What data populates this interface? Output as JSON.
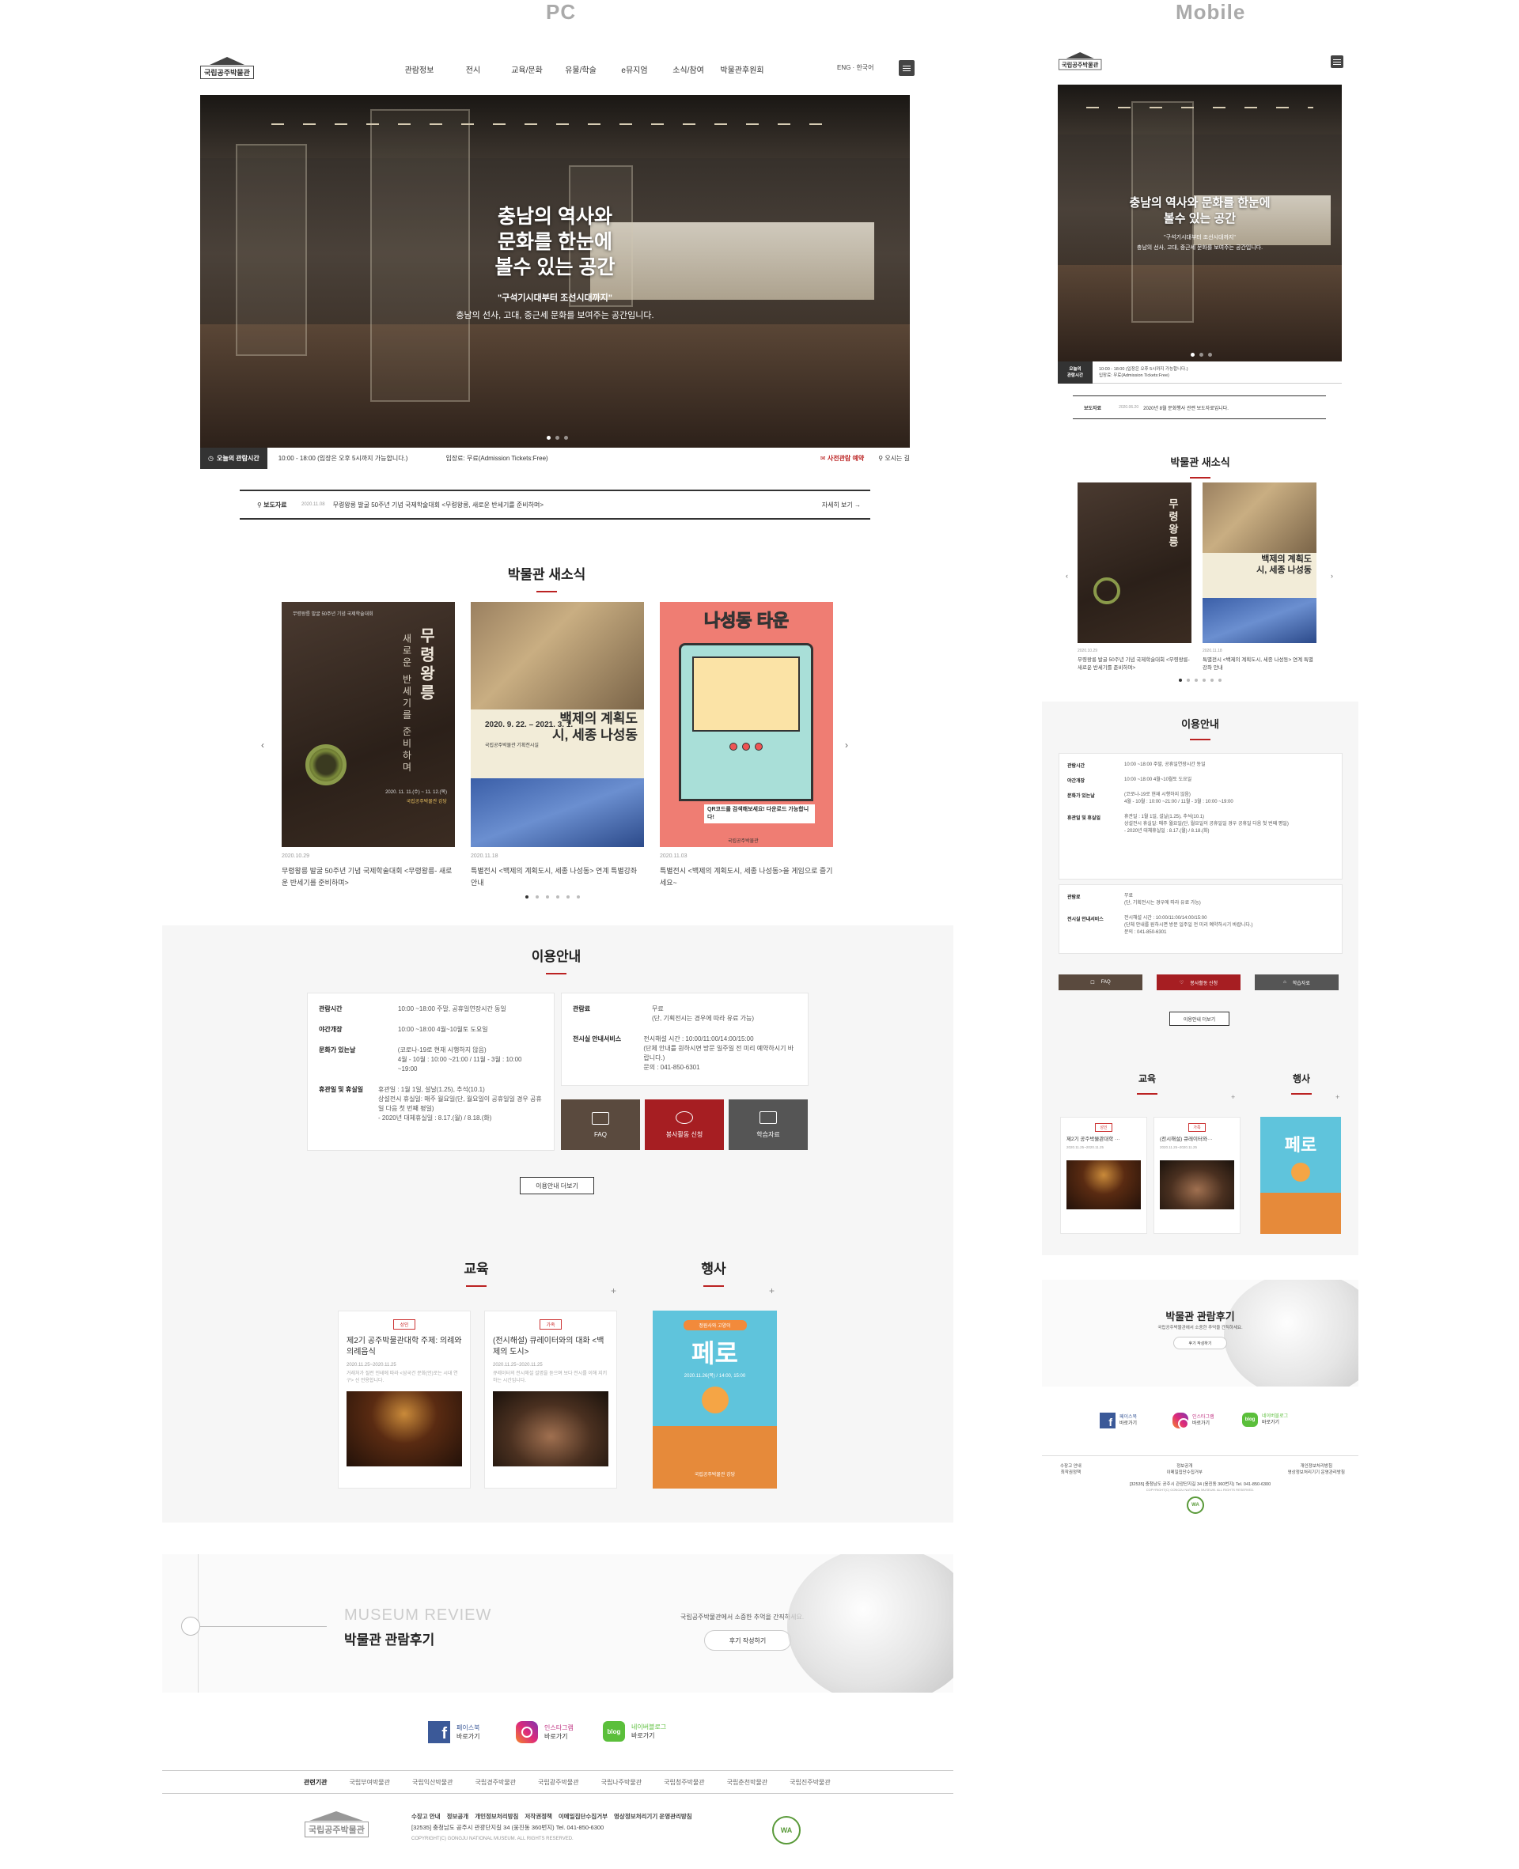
{
  "columns": {
    "pc": "PC",
    "mobile": "Mobile"
  },
  "site": {
    "logo_text": "국립공주박물관"
  },
  "nav": {
    "items": [
      "관람정보",
      "전시",
      "교육/문화",
      "유물/학술",
      "e뮤지엄",
      "소식/참여",
      "박물관후원회"
    ],
    "lang": "ENG · 한국어"
  },
  "hero": {
    "title_lines": [
      "충남의 역사와",
      "문화를 한눈에",
      "볼수 있는 공간"
    ],
    "mobile_title_lines": [
      "충남의 역사와 문화를 한눈에",
      "볼수 있는 공간"
    ],
    "quote": "\"구석기시대부터 조선시대까지\"",
    "desc": "충남의 선사, 고대, 중근세 문화를 보여주는 공간입니다."
  },
  "today": {
    "label": "오늘의 관람시간",
    "mobile_label1": "오늘의",
    "mobile_label2": "관람시간",
    "hours": "10:00 - 18:00 (입장은 오후 5시까지 가능합니다.)",
    "admission": "입장료: 무료(Admission Tickets:Free)",
    "reserve": "사전관람 예약",
    "directions": "오시는 길"
  },
  "press": {
    "label": "보도자료",
    "date": "2020.11.08",
    "text": "무령왕릉 발굴 50주년 기념 국제학술대회 <무령왕릉, 새로운 반세기를 준비하며>",
    "more": "자세히 보기",
    "mobile_date": "2020.06.20",
    "mobile_text": "2020년 8월 문화행사 관련 보도자료입니다."
  },
  "news": {
    "title": "박물관 새소식",
    "items": [
      {
        "date": "2020.10.29",
        "caption": "무령왕릉 발굴 50주년 기념 국제학술대회 <무령왕릉- 새로운 반세기를 준비하며>",
        "poster_title": "무령왕릉",
        "poster_sub": "새로운 반세기를 준비하며",
        "poster_head": "무령왕릉 발굴 50주년 기념 국제학술대회",
        "poster_date": "2020. 11. 11.(수) ~ 11. 12.(목)",
        "poster_org": "국립공주박물관 강당"
      },
      {
        "date": "2020.11.18",
        "caption": "특별전시 <백제의 계획도시, 세종 나성동> 연계 특별강좌 안내",
        "poster_title": "백제의 계획도시, 세종 나성동",
        "poster_date": "2020. 9. 22. – 2021. 3. 1.",
        "poster_org": "국립공주박물관 기획전시실"
      },
      {
        "date": "2020.11.03",
        "caption": "특별전시 <백제의 계획도시, 세종 나성동>을 게임으로 즐기세요~",
        "poster_title": "나성동 타운",
        "poster_qr": "QR코드를 검색해보세요! 다운로드 가능합니다!",
        "poster_org": "국립공주박물관"
      }
    ],
    "mobile_items": [
      {
        "date": "2020.10.29",
        "caption": "무령왕릉 발굴 50주년 기념 국제학술대회 <무령왕릉- 새로운 반세기를 준비하며>"
      },
      {
        "date": "2020.11.18",
        "caption": "특별전시 <백제의 계획도시, 세종 나성동> 연계 특별강좌 안내"
      }
    ]
  },
  "guide": {
    "title": "이용안내",
    "rows": [
      {
        "k": "관람시간",
        "v": "10:00 ~18:00 주말, 공휴일연장시간 동일"
      },
      {
        "k": "야간개장",
        "v": "10:00 ~18:00 4월~10월토 도요일"
      },
      {
        "k": "문화가 있는날",
        "v": "(코로나-19로 현재 시행하지 않음)",
        "v2": "4월 - 10월 : 10:00 ~21:00 / 11월 - 3월 : 10:00 ~19:00"
      },
      {
        "k": "휴관일 및 휴실일",
        "v": "휴관일 : 1월 1일, 설날(1.25), 추석(10.1)",
        "v2": "상설전시 휴실일: 매주 월요일(단, 월요일이 공휴일일 경우 공휴일 다음 첫 번째 평일)",
        "v3": "- 2020년 대체휴실일 : 8.17.(월) / 8.18.(화)"
      }
    ],
    "rows2": [
      {
        "k": "관람료",
        "v": "무료",
        "v2": "(단, 기획전시는 경우에 따라 유료 가능)"
      },
      {
        "k": "전시실 안내서비스",
        "v": "전시해설 시간 : 10:00/11:00/14:00/15:00",
        "v2": "(단체 안내를 원하시면 방문 일주일 전 미리 예약하시기 바랍니다.)",
        "v3": "문의 : 041-850-6301"
      }
    ],
    "buttons": [
      {
        "label": "FAQ",
        "color": "#5a4a3e"
      },
      {
        "label": "봉사활동 신청",
        "color": "#a61e22"
      },
      {
        "label": "학습자료",
        "color": "#555"
      }
    ],
    "more": "이용안내 더보기"
  },
  "edu": {
    "title": "교육",
    "items": [
      {
        "badge": "성인",
        "title": "제2기 공주박물관대학 주제: 의례와 의례음식",
        "mobile_title": "제2기 공주박물관대학 ···",
        "date": "2020.11.25~2020.11.25",
        "desc": "거래처가 질런 인테에 따라 <삼국건 문화(언)로는 시대 연구> 선 전용합니다."
      },
      {
        "badge": "가족",
        "title": "(전시해설) 큐레이터와의 대화 <백제의 도시>",
        "mobile_title": "(전시해설) 큐레이터와···",
        "date": "2020.11.25~2020.11.25",
        "desc": "큐레이터의 전시해설 설명을 듣으며 보다 전시를 이해 지키하는 시간입니다."
      }
    ]
  },
  "event": {
    "title": "행사",
    "poster_top": "정원사와 고양이",
    "poster_title": "페로",
    "poster_date": "2020.11.26(목) / 14:00, 15:00",
    "poster_place": "국립공주박물관 강당"
  },
  "review": {
    "en": "MUSEUM REVIEW",
    "title": "박물관 관람후기",
    "desc": "국립공주박물관에서 소중한 추억을 간직하세요.",
    "button": "후기 작성하기"
  },
  "social": [
    {
      "name": "페이스북",
      "go": "바로가기"
    },
    {
      "name": "인스타그램",
      "go": "바로가기"
    },
    {
      "name": "네이버블로그",
      "go": "바로가기",
      "icon": "blog"
    }
  ],
  "footer": {
    "related_label": "관련기관",
    "related": [
      "국립부여박물관",
      "국립익산박물관",
      "국립경주박물관",
      "국립광주박물관",
      "국립나주박물관",
      "국립청주박물관",
      "국립춘천박물관",
      "국립진주박물관"
    ],
    "links": [
      "수장고 안내",
      "정보공개",
      "개인정보처리방침",
      "저작권정책",
      "이메일집단수집거부",
      "영상정보처리기기 운영관리방침"
    ],
    "address": "[32535] 충청남도 공주시 관광단지길 34 (웅진동 360번지) Tel. 041-850-6300",
    "copyright": "COPYRIGHT(C) GONGJU NATIONAL MUSEUM. ALL RIGHTS RESERVED.",
    "mobile_links": [
      [
        "수장고 안내",
        "최작권정책"
      ],
      [
        "정보공개",
        "이메일집단수집거부"
      ],
      [
        "개인정보처리방침",
        "영상정보처리기기 운영관리방침"
      ]
    ],
    "wa": "WA"
  }
}
